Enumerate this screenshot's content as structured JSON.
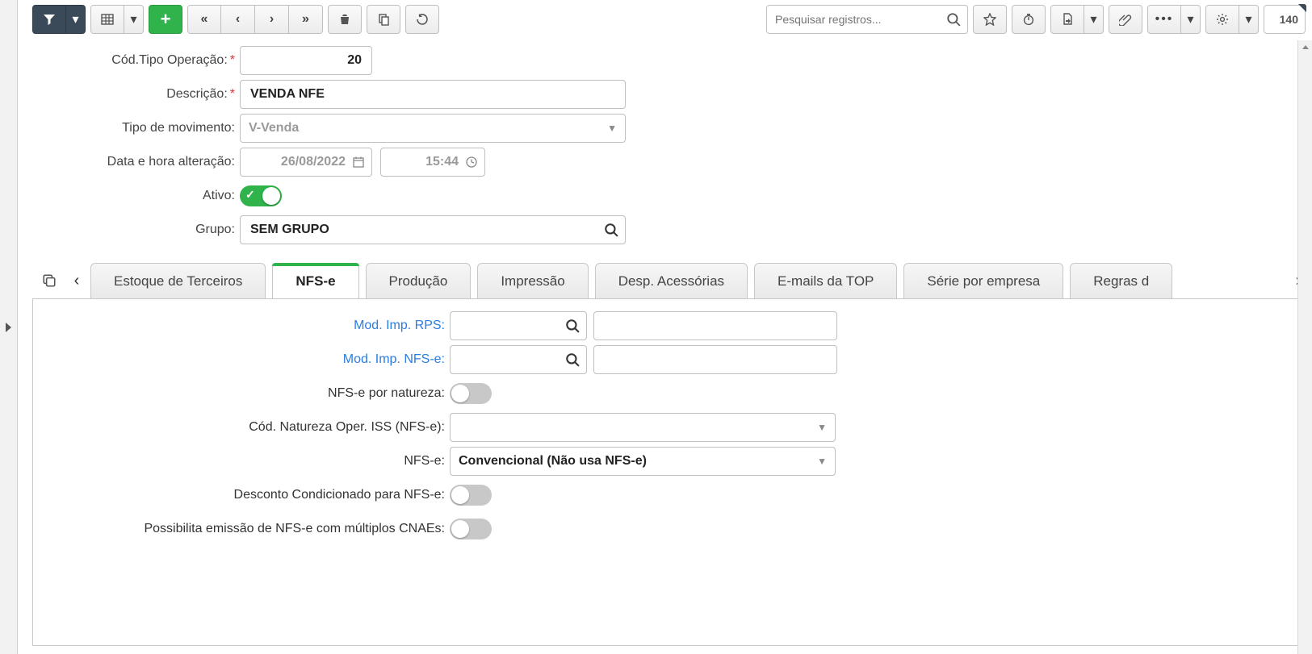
{
  "toolbar": {
    "search_placeholder": "Pesquisar registros...",
    "record_count": "140"
  },
  "form": {
    "labels": {
      "cod_tipo_operacao": "Cód.Tipo Operação:",
      "descricao": "Descrição:",
      "tipo_movimento": "Tipo de movimento:",
      "data_hora_alteracao": "Data e hora alteração:",
      "ativo": "Ativo:",
      "grupo": "Grupo:"
    },
    "values": {
      "cod_tipo_operacao": "20",
      "descricao": "VENDA NFE",
      "tipo_movimento": "V-Venda",
      "data_alteracao": "26/08/2022",
      "hora_alteracao": "15:44",
      "ativo": true,
      "grupo": "SEM GRUPO"
    }
  },
  "tabs": {
    "items": [
      {
        "label": "Estoque de Terceiros",
        "active": false
      },
      {
        "label": "NFS-e",
        "active": true
      },
      {
        "label": "Produção",
        "active": false
      },
      {
        "label": "Impressão",
        "active": false
      },
      {
        "label": "Desp. Acessórias",
        "active": false
      },
      {
        "label": "E-mails da TOP",
        "active": false
      },
      {
        "label": "Série por empresa",
        "active": false
      },
      {
        "label": "Regras d",
        "active": false
      }
    ]
  },
  "nfse": {
    "labels": {
      "mod_imp_rps": "Mod. Imp. RPS:",
      "mod_imp_nfse": "Mod. Imp. NFS-e:",
      "nfse_por_natureza": "NFS-e por natureza:",
      "cod_natureza_iss": "Cód. Natureza Oper. ISS (NFS-e):",
      "nfse": "NFS-e:",
      "desconto_cond": "Desconto Condicionado para NFS-e:",
      "multiplos_cnae": "Possibilita emissão de NFS-e com múltiplos CNAEs:"
    },
    "values": {
      "mod_imp_rps_code": "",
      "mod_imp_rps_desc": "",
      "mod_imp_nfse_code": "",
      "mod_imp_nfse_desc": "",
      "nfse_por_natureza": false,
      "cod_natureza_iss": "",
      "nfse": "Convencional (Não usa NFS-e)",
      "desconto_cond": false,
      "multiplos_cnae": false
    }
  }
}
